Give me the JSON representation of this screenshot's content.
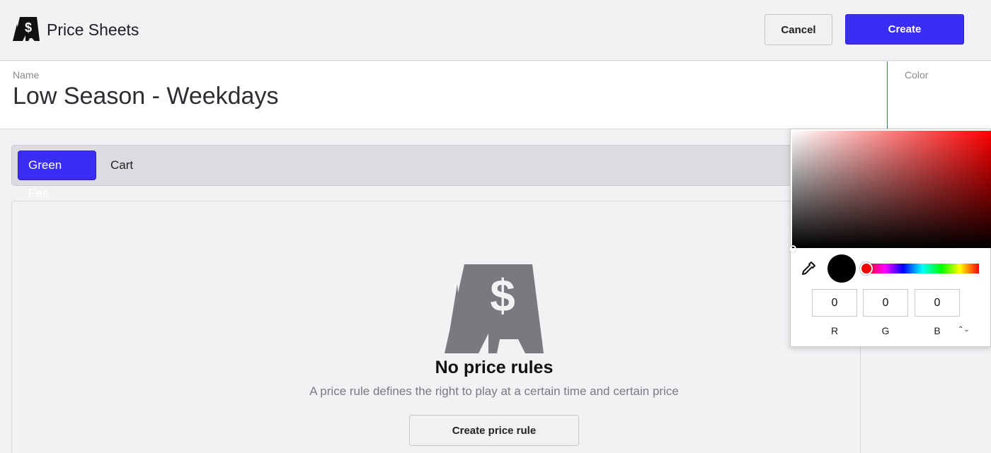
{
  "header": {
    "title": "Price Sheets",
    "cancel_label": "Cancel",
    "create_label": "Create"
  },
  "form": {
    "name_label": "Name",
    "name_value": "Low Season - Weekdays",
    "color_label": "Color"
  },
  "tabs": [
    {
      "label": "Green Fee",
      "active": true
    },
    {
      "label": "Cart",
      "active": false
    }
  ],
  "empty_state": {
    "title": "No price rules",
    "description": "A price rule defines the right to play at a certain time and certain price",
    "button_label": "Create price rule"
  },
  "color_picker": {
    "selected_color": "#000000",
    "hue_color": "#ff0000",
    "r": "0",
    "g": "0",
    "b": "0",
    "r_label": "R",
    "g_label": "G",
    "b_label": "B"
  },
  "colors": {
    "accent": "#3a2ef5",
    "icon_gray": "#7a7a7e"
  }
}
